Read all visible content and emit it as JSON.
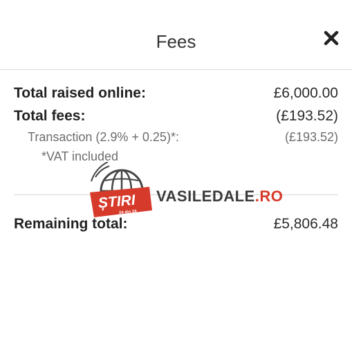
{
  "header": {
    "title": "Fees"
  },
  "summary": {
    "total_raised_label": "Total raised online:",
    "total_raised_value": "£6,000.00",
    "total_fees_label": "Total fees:",
    "total_fees_value": "(£193.52)",
    "transaction_label": "Transaction (2.9% + 0.25)*:",
    "transaction_value": "(£193.52)",
    "vat_note": "*VAT included",
    "remaining_label": "Remaining total:",
    "remaining_value": "£5,806.48"
  },
  "watermark": {
    "badge_text": "ȘTIRI",
    "badge_subtext": "24 din 24",
    "site_main": "VASILEDALE",
    "site_tld": ".RO"
  },
  "colors": {
    "accent_red": "#d63a2a",
    "text_dark": "#222222",
    "text_muted": "#6d6d6d"
  },
  "icons": {
    "close": "close-icon",
    "globe": "globe-icon"
  }
}
